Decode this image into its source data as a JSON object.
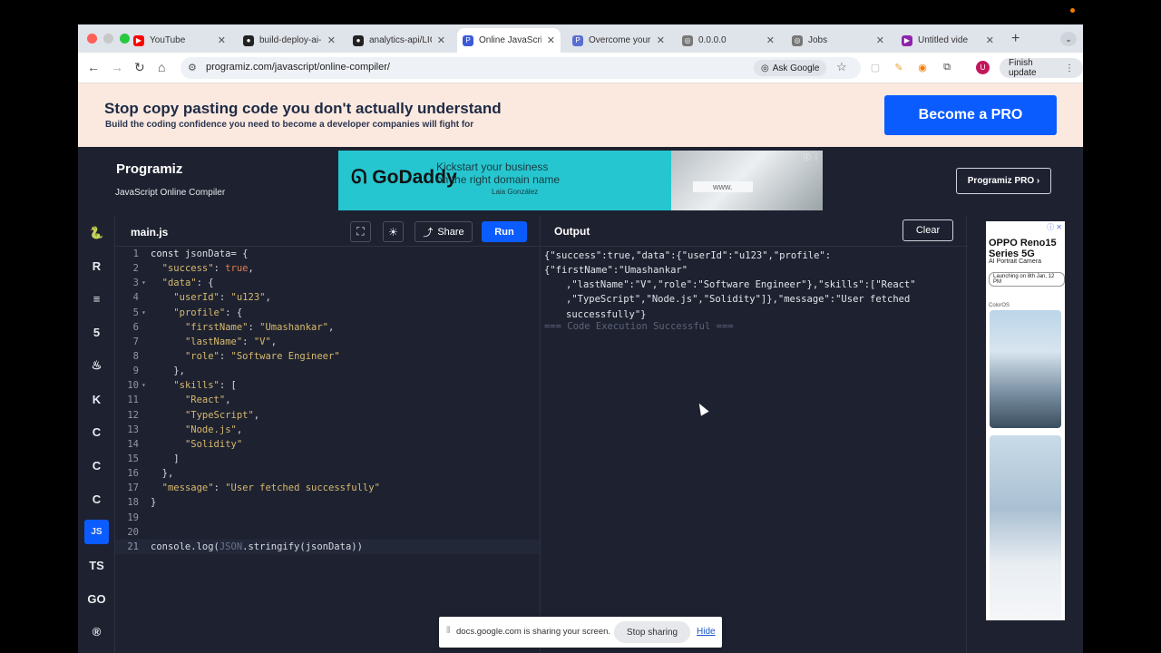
{
  "browser": {
    "tabs": [
      {
        "title": "YouTube",
        "favicon": "youtube-icon",
        "color": "#ff0000",
        "glyph": "▶"
      },
      {
        "title": "build-deploy-ai-",
        "favicon": "github-icon",
        "color": "#222222",
        "glyph": "●"
      },
      {
        "title": "analytics-api/LIC",
        "favicon": "github-icon",
        "color": "#222222",
        "glyph": "●"
      },
      {
        "title": "Online JavaScrip",
        "favicon": "programiz-icon",
        "color": "#3b5bdb",
        "glyph": "P",
        "active": true
      },
      {
        "title": "Overcome your f",
        "favicon": "programiz-icon",
        "color": "#5a6fd0",
        "glyph": "P"
      },
      {
        "title": "0.0.0.0",
        "favicon": "globe-icon",
        "color": "#777777",
        "glyph": "◎"
      },
      {
        "title": "Jobs",
        "favicon": "globe-icon",
        "color": "#777777",
        "glyph": "◎"
      },
      {
        "title": "Untitled vide",
        "favicon": "video-icon",
        "color": "#8e24aa",
        "glyph": "▶"
      }
    ],
    "new_tab": "+",
    "url": "programiz.com/javascript/online-compiler/",
    "ask_google": "Ask Google",
    "finish_update": "Finish update",
    "avatar_letter": "U"
  },
  "promo": {
    "headline": "Stop copy pasting code you don't actually understand",
    "subline": "Build the coding confidence you need to become a developer companies will fight for",
    "cta": "Become a PRO"
  },
  "header": {
    "logo": "Programiz",
    "subtitle": "JavaScript Online Compiler",
    "pro_button": "Programiz PRO ›",
    "ad": {
      "brand": "GoDaddy",
      "line1": "Kickstart your business",
      "line2": "on the right domain name",
      "person": "Laia González",
      "field": "www."
    }
  },
  "rail": {
    "languages": [
      {
        "name": "python",
        "glyph": "🐍"
      },
      {
        "name": "r",
        "glyph": "R"
      },
      {
        "name": "sql",
        "glyph": "≡"
      },
      {
        "name": "html",
        "glyph": "5"
      },
      {
        "name": "java",
        "glyph": "♨"
      },
      {
        "name": "kotlin",
        "glyph": "K"
      },
      {
        "name": "c",
        "glyph": "C"
      },
      {
        "name": "cpp",
        "glyph": "C"
      },
      {
        "name": "csharp",
        "glyph": "C"
      },
      {
        "name": "javascript",
        "glyph": "JS",
        "active": true
      },
      {
        "name": "typescript",
        "glyph": "TS"
      },
      {
        "name": "go",
        "glyph": "GO"
      },
      {
        "name": "rust",
        "glyph": "®"
      }
    ]
  },
  "editor": {
    "filename": "main.js",
    "share_label": "Share",
    "run_label": "Run",
    "lines": [
      {
        "n": "1",
        "fold": "",
        "html": "<span class=\"k\">const</span> jsonData= {"
      },
      {
        "n": "2",
        "fold": "",
        "html": "  <span class=\"p\">\"success\"</span>: <span class=\"b\">true</span>,"
      },
      {
        "n": "3",
        "fold": "▾",
        "html": "  <span class=\"p\">\"data\"</span>: {"
      },
      {
        "n": "4",
        "fold": "",
        "html": "    <span class=\"p\">\"userId\"</span>: <span class=\"s\">\"u123\"</span>,"
      },
      {
        "n": "5",
        "fold": "▾",
        "html": "    <span class=\"p\">\"profile\"</span>: {"
      },
      {
        "n": "6",
        "fold": "",
        "html": "      <span class=\"p\">\"firstName\"</span>: <span class=\"s\">\"Umashankar\"</span>,"
      },
      {
        "n": "7",
        "fold": "",
        "html": "      <span class=\"p\">\"lastName\"</span>: <span class=\"s\">\"V\"</span>,"
      },
      {
        "n": "8",
        "fold": "",
        "html": "      <span class=\"p\">\"role\"</span>: <span class=\"s\">\"Software Engineer\"</span>"
      },
      {
        "n": "9",
        "fold": "",
        "html": "    },"
      },
      {
        "n": "10",
        "fold": "▾",
        "html": "    <span class=\"p\">\"skills\"</span>: ["
      },
      {
        "n": "11",
        "fold": "",
        "html": "      <span class=\"s\">\"React\"</span>,"
      },
      {
        "n": "12",
        "fold": "",
        "html": "      <span class=\"s\">\"TypeScript\"</span>,"
      },
      {
        "n": "13",
        "fold": "",
        "html": "      <span class=\"s\">\"Node.js\"</span>,"
      },
      {
        "n": "14",
        "fold": "",
        "html": "      <span class=\"s\">\"Solidity\"</span>"
      },
      {
        "n": "15",
        "fold": "",
        "html": "    ]"
      },
      {
        "n": "16",
        "fold": "",
        "html": "  },"
      },
      {
        "n": "17",
        "fold": "",
        "html": "  <span class=\"p\">\"message\"</span>: <span class=\"s\">\"User fetched successfully\"</span>"
      },
      {
        "n": "18",
        "fold": "",
        "html": "}"
      },
      {
        "n": "19",
        "fold": "",
        "html": ""
      },
      {
        "n": "20",
        "fold": "",
        "html": ""
      },
      {
        "n": "21",
        "fold": "",
        "html": "console.log(<span class=\"c\">JSON</span>.stringify(jsonData))",
        "current": true
      }
    ]
  },
  "output": {
    "title": "Output",
    "clear_label": "Clear",
    "lines": [
      "{\"success\":true,\"data\":{\"userId\":\"u123\",\"profile\":{\"firstName\":\"Umashankar\"",
      ",\"lastName\":\"V\",\"role\":\"Software Engineer\"},\"skills\":[\"React\"",
      ",\"TypeScript\",\"Node.js\",\"Solidity\"]},\"message\":\"User fetched",
      "successfully\"}"
    ],
    "status": "=== Code Execution Successful ==="
  },
  "side_ad": {
    "brand": "OPPO Reno15 Series 5G",
    "subtitle": "AI Portrait Camera",
    "launch": "Launching on 8th Jan, 12 PM",
    "os": "ColorOS"
  },
  "screen_share": {
    "message": "docs.google.com is sharing your screen.",
    "stop_label": "Stop sharing",
    "hide_label": "Hide"
  }
}
